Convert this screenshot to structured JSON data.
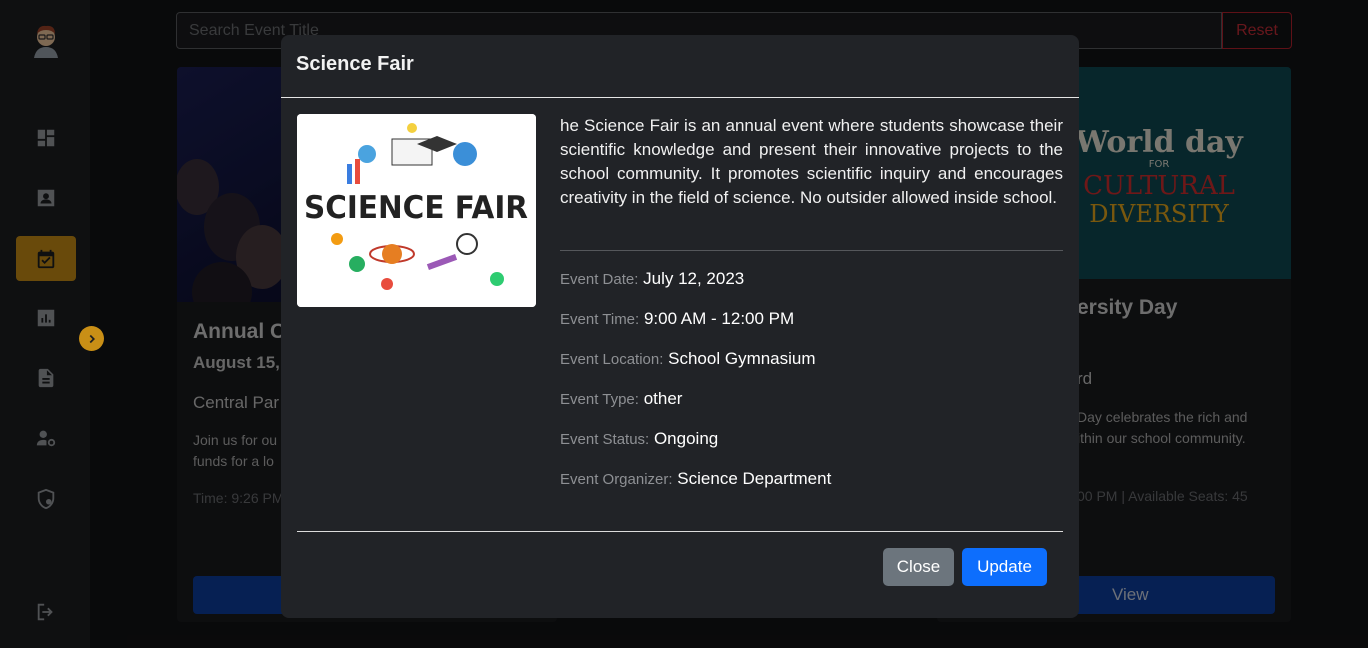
{
  "search": {
    "placeholder": "Search Event Title",
    "reset_label": "Reset"
  },
  "sidebar": {
    "items": [
      {
        "icon": "dashboard-icon"
      },
      {
        "icon": "profile-icon"
      },
      {
        "icon": "calendar-check-icon",
        "active": true
      },
      {
        "icon": "chart-icon"
      },
      {
        "icon": "document-icon"
      },
      {
        "icon": "user-settings-icon"
      },
      {
        "icon": "shield-icon"
      },
      {
        "icon": "logout-icon"
      }
    ]
  },
  "cards": [
    {
      "title": "Annual C",
      "date": "August 15, 2",
      "location": "Central Par",
      "desc_line1": "Join us for ou",
      "desc_line2": "funds for a lo",
      "meta": "Time: 9:26 PM"
    },
    {
      "title": "ersity Day",
      "location": "rd",
      "desc_line1": "Day celebrates the rich and",
      "desc_line2": "ithin our school community.",
      "meta": "00 PM | Available Seats: 45",
      "view_label": "View",
      "image_text_1": "World day",
      "image_text_2": "FOR",
      "image_text_3": "CULTURAL",
      "image_text_4": "DIVERSITY"
    }
  ],
  "modal": {
    "title": "Science Fair",
    "image_text": "SCIENCE FAIR",
    "description": "he Science Fair is an annual event where students showcase their scientific knowledge and present their innovative projects to the school community. It promotes scientific inquiry and encourages creativity in the field of science. No outsider allowed inside school.",
    "details": [
      {
        "label": "Event Date:",
        "value": "July 12, 2023"
      },
      {
        "label": "Event Time:",
        "value": "9:00 AM - 12:00 PM"
      },
      {
        "label": "Event Location:",
        "value": "School Gymnasium"
      },
      {
        "label": "Event Type:",
        "value": "other"
      },
      {
        "label": "Event Status:",
        "value": "Ongoing"
      },
      {
        "label": "Event Organizer:",
        "value": "Science Department"
      }
    ],
    "close_label": "Close",
    "update_label": "Update"
  },
  "colors": {
    "accent": "#c98f16",
    "primary": "#0d6efd",
    "danger": "#c62c37",
    "secondary": "#6c757d"
  }
}
